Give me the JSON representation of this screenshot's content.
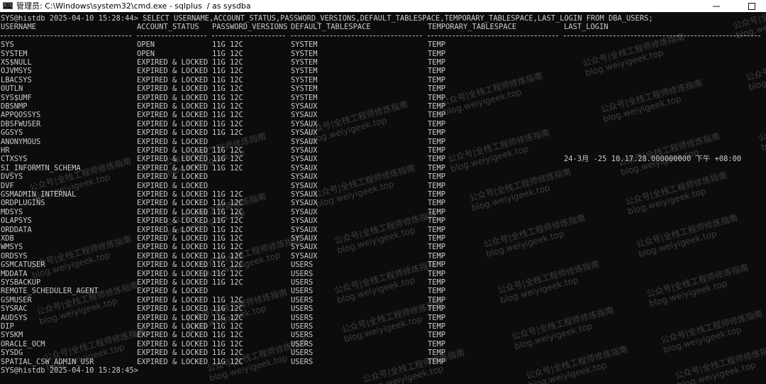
{
  "window": {
    "icon": "cmd-icon",
    "title": "管理员: C:\\Windows\\system32\\cmd.exe - sqlplus  / as sysdba"
  },
  "terminal": {
    "prompt_line": "SYS@histdb 2025-04-10 15:28:44> SELECT USERNAME,ACCOUNT_STATUS,PASSWORD_VERSIONS,DEFAULT_TABLESPACE,TEMPORARY_TABLESPACE,LAST_LOGIN FROM DBA_USERS;",
    "headers": [
      "USERNAME",
      "ACCOUNT_STATUS",
      "PASSWORD_VERSIONS",
      "DEFAULT_TABLESPACE",
      "TEMPORARY_TABLESPACE",
      "LAST_LOGIN"
    ],
    "rows": [
      [
        "SYS",
        "OPEN",
        "11G 12C",
        "SYSTEM",
        "TEMP",
        ""
      ],
      [
        "SYSTEM",
        "OPEN",
        "11G 12C",
        "SYSTEM",
        "TEMP",
        ""
      ],
      [
        "XS$NULL",
        "EXPIRED & LOCKED",
        "11G 12C",
        "SYSTEM",
        "TEMP",
        ""
      ],
      [
        "OJVMSYS",
        "EXPIRED & LOCKED",
        "11G 12C",
        "SYSTEM",
        "TEMP",
        ""
      ],
      [
        "LBACSYS",
        "EXPIRED & LOCKED",
        "11G 12C",
        "SYSTEM",
        "TEMP",
        ""
      ],
      [
        "OUTLN",
        "EXPIRED & LOCKED",
        "11G 12C",
        "SYSTEM",
        "TEMP",
        ""
      ],
      [
        "SYS$UMF",
        "EXPIRED & LOCKED",
        "11G 12C",
        "SYSTEM",
        "TEMP",
        ""
      ],
      [
        "DBSNMP",
        "EXPIRED & LOCKED",
        "11G 12C",
        "SYSAUX",
        "TEMP",
        ""
      ],
      [
        "APPQOSSYS",
        "EXPIRED & LOCKED",
        "11G 12C",
        "SYSAUX",
        "TEMP",
        ""
      ],
      [
        "DBSFWUSER",
        "EXPIRED & LOCKED",
        "11G 12C",
        "SYSAUX",
        "TEMP",
        ""
      ],
      [
        "GGSYS",
        "EXPIRED & LOCKED",
        "11G 12C",
        "SYSAUX",
        "TEMP",
        ""
      ],
      [
        "ANONYMOUS",
        "EXPIRED & LOCKED",
        "",
        "SYSAUX",
        "TEMP",
        ""
      ],
      [
        "HR",
        "EXPIRED & LOCKED",
        "11G 12C",
        "SYSAUX",
        "TEMP",
        ""
      ],
      [
        "CTXSYS",
        "EXPIRED & LOCKED",
        "11G 12C",
        "SYSAUX",
        "TEMP",
        "24-3月 -25 10.17.28.000000000 下午 +08:00"
      ],
      [
        "SI_INFORMTN_SCHEMA",
        "EXPIRED & LOCKED",
        "11G 12C",
        "SYSAUX",
        "TEMP",
        ""
      ],
      [
        "DVSYS",
        "EXPIRED & LOCKED",
        "",
        "SYSAUX",
        "TEMP",
        ""
      ],
      [
        "DVF",
        "EXPIRED & LOCKED",
        "",
        "SYSAUX",
        "TEMP",
        ""
      ],
      [
        "GSMADMIN_INTERNAL",
        "EXPIRED & LOCKED",
        "11G 12C",
        "SYSAUX",
        "TEMP",
        ""
      ],
      [
        "ORDPLUGINS",
        "EXPIRED & LOCKED",
        "11G 12C",
        "SYSAUX",
        "TEMP",
        ""
      ],
      [
        "MDSYS",
        "EXPIRED & LOCKED",
        "11G 12C",
        "SYSAUX",
        "TEMP",
        ""
      ],
      [
        "OLAPSYS",
        "EXPIRED & LOCKED",
        "11G 12C",
        "SYSAUX",
        "TEMP",
        ""
      ],
      [
        "ORDDATA",
        "EXPIRED & LOCKED",
        "11G 12C",
        "SYSAUX",
        "TEMP",
        ""
      ],
      [
        "XDB",
        "EXPIRED & LOCKED",
        "11G 12C",
        "SYSAUX",
        "TEMP",
        ""
      ],
      [
        "WMSYS",
        "EXPIRED & LOCKED",
        "11G 12C",
        "SYSAUX",
        "TEMP",
        ""
      ],
      [
        "ORDSYS",
        "EXPIRED & LOCKED",
        "11G 12C",
        "SYSAUX",
        "TEMP",
        ""
      ],
      [
        "GSMCATUSER",
        "EXPIRED & LOCKED",
        "11G 12C",
        "USERS",
        "TEMP",
        ""
      ],
      [
        "MDDATA",
        "EXPIRED & LOCKED",
        "11G 12C",
        "USERS",
        "TEMP",
        ""
      ],
      [
        "SYSBACKUP",
        "EXPIRED & LOCKED",
        "11G 12C",
        "USERS",
        "TEMP",
        ""
      ],
      [
        "REMOTE_SCHEDULER_AGENT",
        "EXPIRED & LOCKED",
        "",
        "USERS",
        "TEMP",
        ""
      ],
      [
        "GSMUSER",
        "EXPIRED & LOCKED",
        "11G 12C",
        "USERS",
        "TEMP",
        ""
      ],
      [
        "SYSRAC",
        "EXPIRED & LOCKED",
        "11G 12C",
        "USERS",
        "TEMP",
        ""
      ],
      [
        "AUDSYS",
        "EXPIRED & LOCKED",
        "11G 12C",
        "USERS",
        "TEMP",
        ""
      ],
      [
        "DIP",
        "EXPIRED & LOCKED",
        "11G 12C",
        "USERS",
        "TEMP",
        ""
      ],
      [
        "SYSKM",
        "EXPIRED & LOCKED",
        "11G 12C",
        "USERS",
        "TEMP",
        ""
      ],
      [
        "ORACLE_OCM",
        "EXPIRED & LOCKED",
        "11G 12C",
        "USERS",
        "TEMP",
        ""
      ],
      [
        "SYSDG",
        "EXPIRED & LOCKED",
        "11G 12C",
        "USERS",
        "TEMP",
        ""
      ],
      [
        "SPATIAL_CSW_ADMIN_USR",
        "EXPIRED & LOCKED",
        "11G 12C",
        "USERS",
        "TEMP",
        ""
      ]
    ],
    "end_prompt": "SYS@histdb 2025-04-10 15:28:45>"
  },
  "watermark": {
    "line1": "公众号|全栈工程师修炼指南",
    "line2": "blog.weiyigeek.top"
  },
  "colors": {
    "terminal_bg": "#0c0c0c",
    "terminal_text": "#cccccc",
    "titlebar_bg": "#ffffff"
  }
}
